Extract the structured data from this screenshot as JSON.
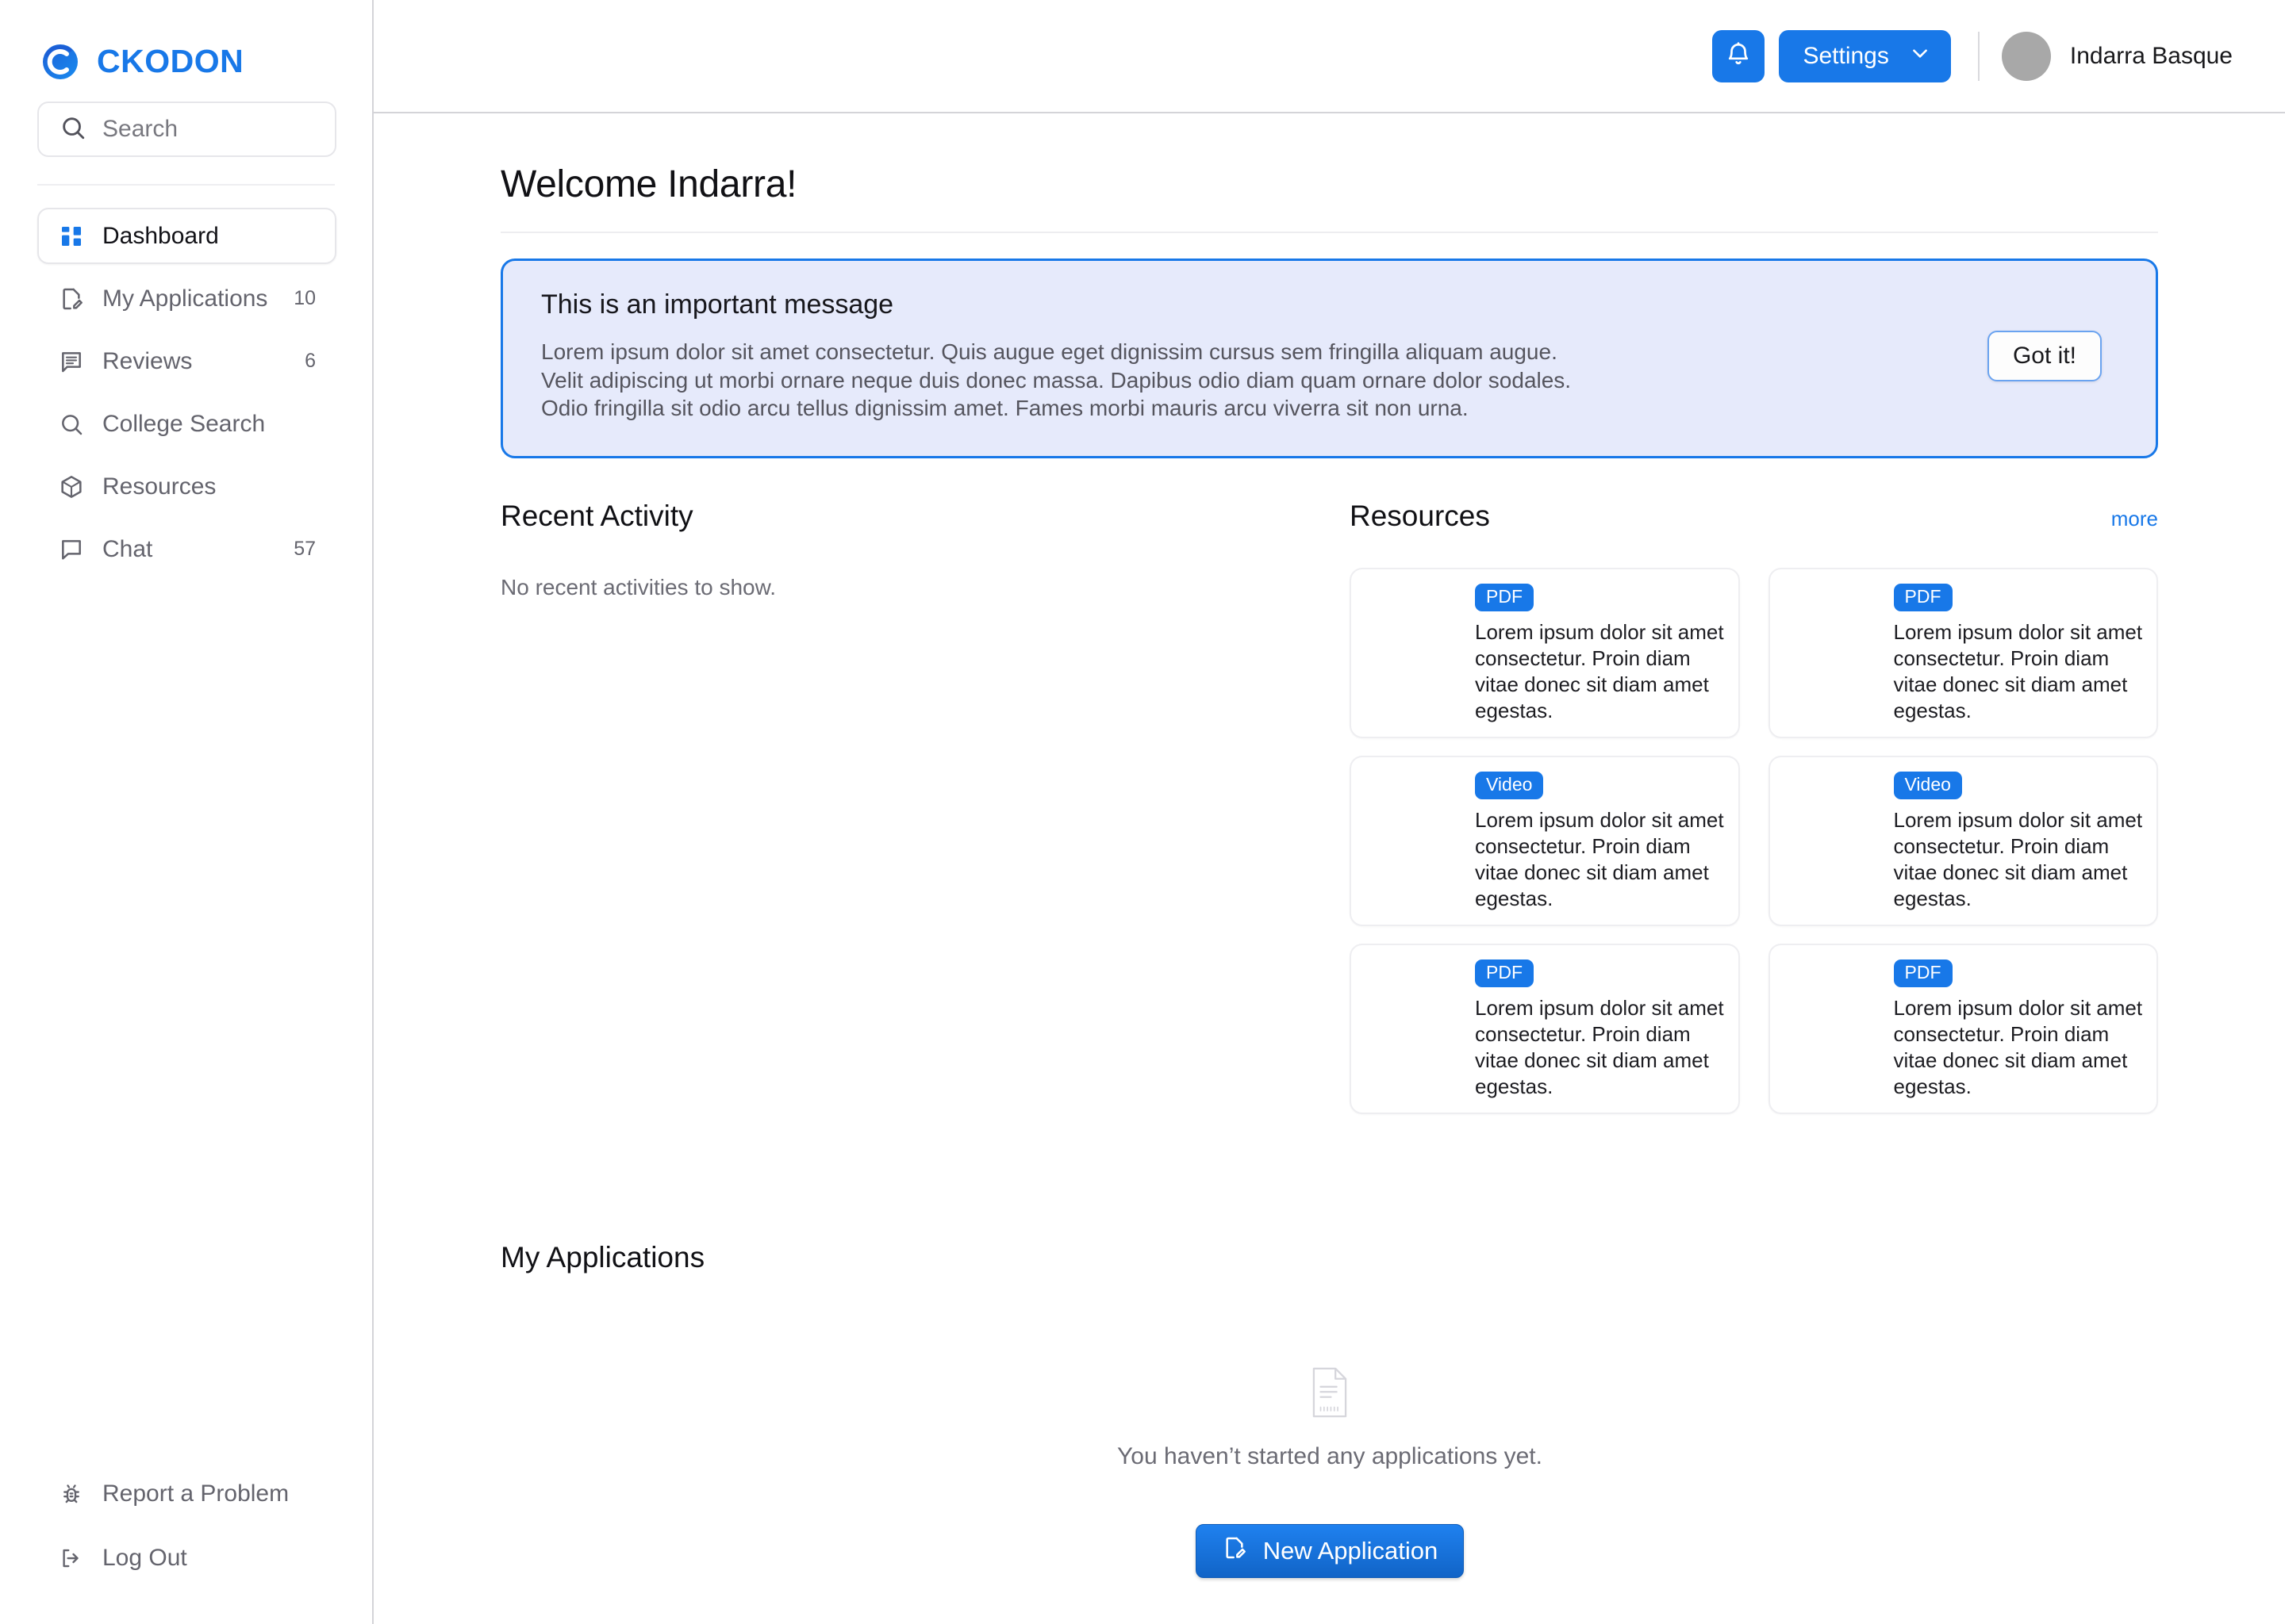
{
  "brand": {
    "name": "CKODON",
    "logo_icon": "ckodon-logo-icon",
    "accent": "#1878e8"
  },
  "sidebar": {
    "search": {
      "placeholder": "Search",
      "value": "",
      "icon": "search-icon"
    },
    "items": [
      {
        "label": "Dashboard",
        "icon": "dashboard-grid-icon",
        "count": "",
        "active": true
      },
      {
        "label": "My Applications",
        "icon": "document-edit-icon",
        "count": "10",
        "active": false
      },
      {
        "label": "Reviews",
        "icon": "review-comment-icon",
        "count": "6",
        "active": false
      },
      {
        "label": "College Search",
        "icon": "search-icon",
        "count": "",
        "active": false
      },
      {
        "label": "Resources",
        "icon": "package-box-icon",
        "count": "",
        "active": false
      },
      {
        "label": "Chat",
        "icon": "chat-bubble-icon",
        "count": "57",
        "active": false
      }
    ],
    "bottom_items": [
      {
        "label": "Report a Problem",
        "icon": "bug-icon"
      },
      {
        "label": "Log Out",
        "icon": "logout-arrow-icon"
      }
    ]
  },
  "topbar": {
    "notifications_icon": "bell-icon",
    "settings_label": "Settings",
    "settings_chevron_icon": "chevron-down-icon",
    "user_name": "Indarra Basque",
    "avatar_icon": "avatar"
  },
  "page": {
    "title": "Welcome Indarra!"
  },
  "banner": {
    "title": "This is an important message",
    "line1": "Lorem ipsum dolor sit amet consectetur. Quis augue eget dignissim cursus sem fringilla aliquam augue.",
    "line2": "Velit adipiscing ut morbi ornare neque duis donec massa. Dapibus odio diam quam ornare dolor sodales.",
    "line3": "Odio fringilla sit odio arcu tellus dignissim amet. Fames morbi mauris arcu viverra sit non urna.",
    "dismiss_label": "Got it!",
    "bg": "#e6eafb",
    "border": "#1878e8"
  },
  "recent_activity": {
    "title": "Recent Activity",
    "empty_text": "No recent activities to show."
  },
  "resources": {
    "title": "Resources",
    "more_label": "more",
    "cards": [
      {
        "badge": "PDF",
        "thumb": "books-thumbnail",
        "desc": "Lorem ipsum dolor sit amet consectetur. Proin diam vitae donec sit diam amet egestas."
      },
      {
        "badge": "PDF",
        "thumb": "books-thumbnail",
        "desc": "Lorem ipsum dolor sit amet consectetur. Proin diam vitae donec sit diam amet egestas."
      },
      {
        "badge": "Video",
        "thumb": "tablet-thumbnail",
        "desc": "Lorem ipsum dolor sit amet consectetur. Proin diam vitae donec sit diam amet egestas."
      },
      {
        "badge": "Video",
        "thumb": "tablet-thumbnail",
        "desc": "Lorem ipsum dolor sit amet consectetur. Proin diam vitae donec sit diam amet egestas."
      },
      {
        "badge": "PDF",
        "thumb": "person-thumbnail",
        "desc": "Lorem ipsum dolor sit amet consectetur. Proin diam vitae donec sit diam amet egestas."
      },
      {
        "badge": "PDF",
        "thumb": "person-thumbnail",
        "desc": "Lorem ipsum dolor sit amet consectetur. Proin diam vitae donec sit diam amet egestas."
      }
    ]
  },
  "my_applications": {
    "title": "My Applications",
    "empty_icon": "document-placeholder-icon",
    "empty_text": "You haven’t started any applications yet.",
    "new_button_label": "New Application",
    "new_button_icon": "document-edit-icon"
  }
}
